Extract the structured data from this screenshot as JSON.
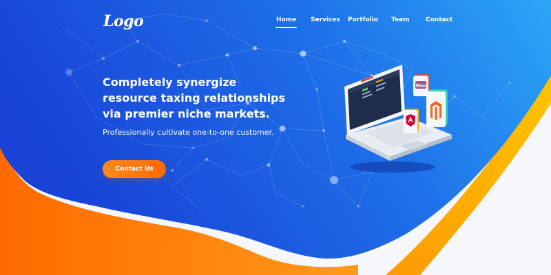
{
  "brand": {
    "logo_text": "Logo"
  },
  "nav": {
    "items": [
      {
        "label": "Home",
        "active": true
      },
      {
        "label": "Services",
        "active": false
      },
      {
        "label": "Portfolio",
        "active": false
      },
      {
        "label": "Team",
        "active": false
      },
      {
        "label": "Contact",
        "active": false
      }
    ]
  },
  "hero": {
    "title": "Completely synergize resource taxing relationships via premier niche markets.",
    "subtitle": "Professionally cultivate one-to-one customer.",
    "cta_label": "Contact Us"
  },
  "illustration": {
    "badges": [
      {
        "icon": "woocommerce-icon",
        "text": "Woo"
      },
      {
        "icon": "magento-icon",
        "text": ""
      },
      {
        "icon": "angular-icon",
        "text": ""
      }
    ]
  },
  "colors": {
    "hero_blue_dark": "#1746d8",
    "hero_blue_light": "#2aa3f5",
    "accent_orange": "#ff7a00",
    "accent_yellow": "#ffb400",
    "page_bg": "#f6f7fa"
  }
}
